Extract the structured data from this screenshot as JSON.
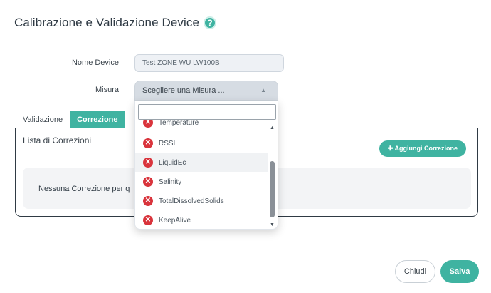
{
  "modal": {
    "title": "Calibrazione e Validazione Device",
    "help_icon": "?"
  },
  "form": {
    "nome_device_label": "Nome Device",
    "nome_device_value": "Test ZONE WU LW100B",
    "misura_label": "Misura",
    "misura_placeholder": "Scegliere una Misura ..."
  },
  "tabs": [
    {
      "label": "Validazione",
      "active": false
    },
    {
      "label": "Correzione",
      "active": true
    }
  ],
  "panel": {
    "title": "Lista di Correzioni",
    "add_button": "✚ Aggiungi Correzione",
    "empty_text": "Nessuna Correzione per q"
  },
  "dropdown": {
    "search_value": "",
    "items": [
      {
        "label": "Temperature",
        "icon": "error-x-icon"
      },
      {
        "label": "RSSI",
        "icon": "error-x-icon"
      },
      {
        "label": "LiquidEc",
        "icon": "error-x-icon",
        "highlighted": true
      },
      {
        "label": "Salinity",
        "icon": "error-x-icon"
      },
      {
        "label": "TotalDissolvedSolids",
        "icon": "error-x-icon"
      },
      {
        "label": "KeepAlive",
        "icon": "error-x-icon"
      }
    ]
  },
  "footer": {
    "close_label": "Chiudi",
    "save_label": "Salva"
  },
  "colors": {
    "accent": "#3fb3a1",
    "error": "#d9343c"
  }
}
